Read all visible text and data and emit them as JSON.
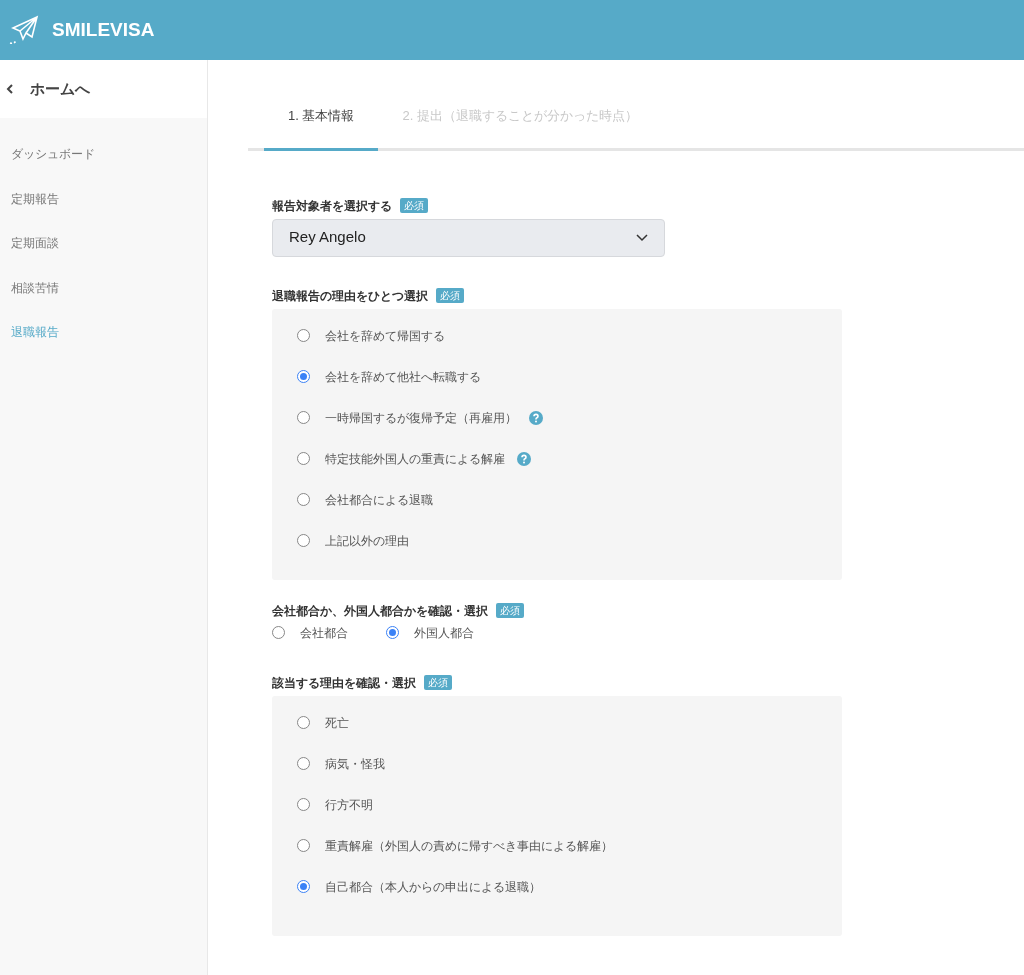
{
  "header": {
    "brand": "SMILEVISA"
  },
  "sidebar": {
    "back": "ホームへ",
    "items": [
      {
        "label": "ダッシュボード",
        "selected": false
      },
      {
        "label": "定期報告",
        "selected": false
      },
      {
        "label": "定期面談",
        "selected": false
      },
      {
        "label": "相談苦情",
        "selected": false
      },
      {
        "label": "退職報告",
        "selected": true
      }
    ]
  },
  "tabs": [
    {
      "label": "1. 基本情報",
      "selected": true
    },
    {
      "label": "2. 提出（退職することが分かった時点）",
      "selected": false
    }
  ],
  "form": {
    "person": {
      "label": "報告対象者を選択する",
      "badge": "必須",
      "value": "Rey Angelo"
    },
    "reason": {
      "label": "退職報告の理由をひとつ選択",
      "badge": "必須",
      "options": [
        {
          "label": "会社を辞めて帰国する",
          "selected": false,
          "help": false
        },
        {
          "label": "会社を辞めて他社へ転職する",
          "selected": true,
          "help": false
        },
        {
          "label": "一時帰国するが復帰予定（再雇用）",
          "selected": false,
          "help": true
        },
        {
          "label": "特定技能外国人の重責による解雇",
          "selected": false,
          "help": true
        },
        {
          "label": "会社都合による退職",
          "selected": false,
          "help": false
        },
        {
          "label": "上記以外の理由",
          "selected": false,
          "help": false
        }
      ]
    },
    "party": {
      "label": "会社都合か、外国人都合かを確認・選択",
      "badge": "必須",
      "options": [
        {
          "label": "会社都合",
          "selected": false
        },
        {
          "label": "外国人都合",
          "selected": true
        }
      ]
    },
    "detail": {
      "label": "該当する理由を確認・選択",
      "badge": "必須",
      "options": [
        {
          "label": "死亡",
          "selected": false
        },
        {
          "label": "病気・怪我",
          "selected": false
        },
        {
          "label": "行方不明",
          "selected": false
        },
        {
          "label": "重責解雇（外国人の責めに帰すべき事由による解雇）",
          "selected": false
        },
        {
          "label": "自己都合（本人からの申出による退職）",
          "selected": true
        }
      ]
    }
  }
}
